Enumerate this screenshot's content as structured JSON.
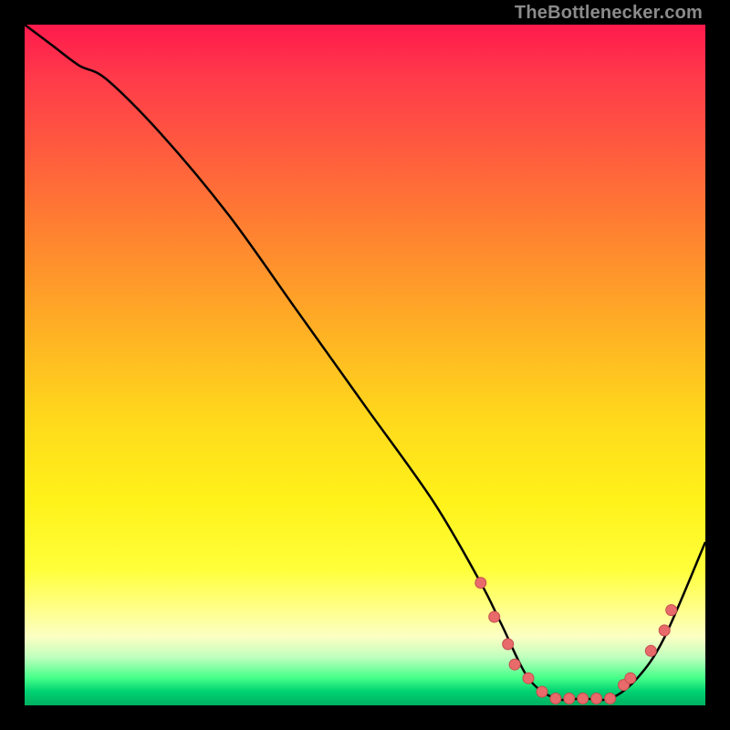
{
  "attribution_text": "TheBottlenecker.com",
  "colors": {
    "background": "#000000",
    "curve_stroke": "#000000",
    "marker_fill": "#e86a6a",
    "marker_stroke": "#c44e4e",
    "gradient_top": "#ff1a4d",
    "gradient_bottom": "#00b060"
  },
  "chart_data": {
    "type": "line",
    "title": "",
    "xlabel": "",
    "ylabel": "",
    "xlim": [
      0,
      100
    ],
    "ylim": [
      0,
      100
    ],
    "grid": false,
    "legend": false,
    "series": [
      {
        "name": "bottleneck-curve",
        "x": [
          0,
          4,
          8,
          12,
          20,
          30,
          40,
          50,
          60,
          67,
          70,
          74,
          78,
          82,
          86,
          90,
          94,
          100
        ],
        "y": [
          100,
          97,
          94,
          92,
          84,
          72,
          58,
          44,
          30,
          18,
          12,
          4,
          1,
          1,
          1,
          4,
          10,
          24
        ]
      }
    ],
    "markers": [
      {
        "x": 67,
        "y": 18
      },
      {
        "x": 69,
        "y": 13
      },
      {
        "x": 71,
        "y": 9
      },
      {
        "x": 72,
        "y": 6
      },
      {
        "x": 74,
        "y": 4
      },
      {
        "x": 76,
        "y": 2
      },
      {
        "x": 78,
        "y": 1
      },
      {
        "x": 80,
        "y": 1
      },
      {
        "x": 82,
        "y": 1
      },
      {
        "x": 84,
        "y": 1
      },
      {
        "x": 86,
        "y": 1
      },
      {
        "x": 88,
        "y": 3
      },
      {
        "x": 89,
        "y": 4
      },
      {
        "x": 92,
        "y": 8
      },
      {
        "x": 94,
        "y": 11
      },
      {
        "x": 95,
        "y": 14
      }
    ]
  }
}
